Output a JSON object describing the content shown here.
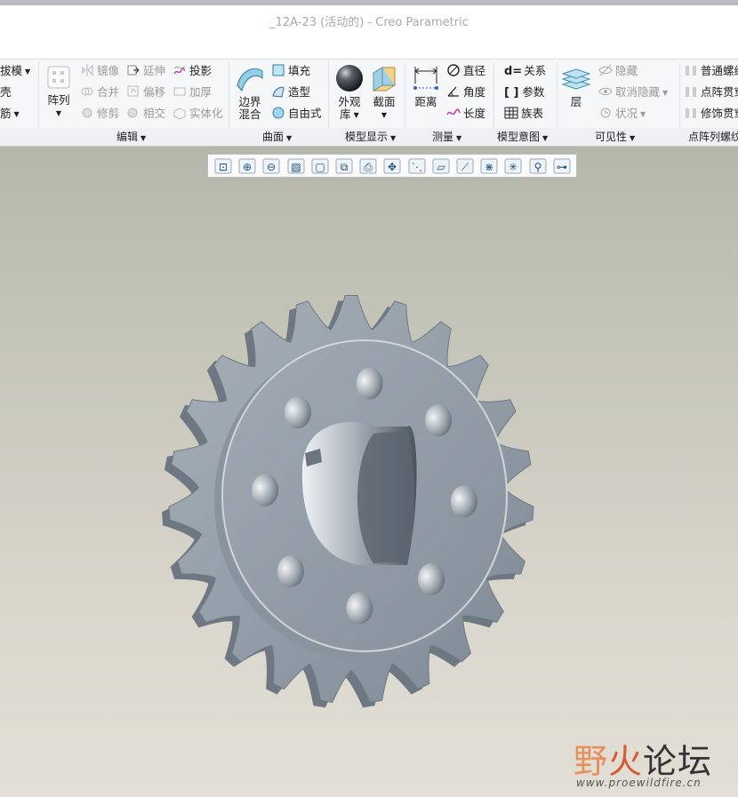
{
  "window": {
    "title": "_12A-23 (活动的) - Creo Parametric"
  },
  "ribbon": {
    "groups": [
      "编辑",
      "曲面",
      "模型显示",
      "测量",
      "模型意图",
      "可见性",
      "点阵列螺纹"
    ],
    "left_partial": [
      "拔模",
      "壳",
      "筋"
    ],
    "edit": {
      "pattern": "阵列",
      "mirror": "镜像",
      "extend": "延伸",
      "project": "投影",
      "merge": "合并",
      "offset": "偏移",
      "thicken": "加厚",
      "trim": "修剪",
      "intersect": "相交",
      "solidify": "实体化"
    },
    "surface": {
      "boundary_line1": "边界",
      "boundary_line2": "混合",
      "fill": "填充",
      "style": "造型",
      "freestyle": "自由式"
    },
    "display": {
      "appearance_line1": "外观",
      "appearance_line2": "库",
      "section": "截面"
    },
    "measure": {
      "distance": "距离",
      "diameter": "直径",
      "angle": "角度",
      "length": "长度"
    },
    "intent": {
      "relations": "关系",
      "parameters": "参数",
      "family_table": "族表"
    },
    "visibility": {
      "layers": "层",
      "hide": "隐藏",
      "unhide": "取消隐藏",
      "status": "状况"
    },
    "thread": {
      "normal": "普通螺纹",
      "pattern_through": "点阵贯穿",
      "cosmetic_through": "修饰贯穿"
    }
  },
  "view_toolbar": {
    "buttons": [
      "refit-icon",
      "zoom-in-icon",
      "zoom-out-icon",
      "repaint-icon",
      "display-style-icon",
      "saved-views-icon",
      "view-manager-icon",
      "perspective-icon",
      "datum-display-filter-icon",
      "datum-planes-icon",
      "datum-axes-icon",
      "datum-points-icon",
      "csys-display-icon",
      "spin-center-icon",
      "annotation-display-icon"
    ]
  },
  "model": {
    "part_name": "_12A-23",
    "teeth": 23,
    "bolt_holes": 8
  },
  "watermark": {
    "part1": "野",
    "part2": "火",
    "part3": "论坛",
    "url": "www.proewildfire.cn"
  },
  "colors": {
    "metal": "#8f99a3",
    "background_top": "#b6b7ab",
    "background_bottom": "#e2dfd6"
  }
}
